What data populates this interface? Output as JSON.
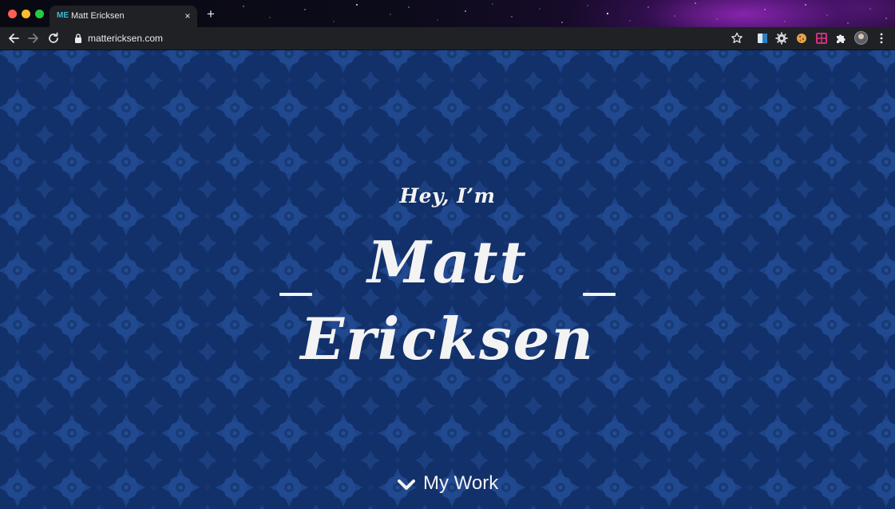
{
  "browser": {
    "tab": {
      "favicon_text": "ME",
      "title": "Matt Ericksen",
      "close_glyph": "×"
    },
    "new_tab_glyph": "+",
    "address_bar": {
      "url": "mattericksen.com"
    },
    "extensions": [
      "reader-extension-icon",
      "settings-gear-extension-icon",
      "cookie-extension-icon",
      "pink-grid-extension-icon"
    ]
  },
  "hero": {
    "greeting": "Hey, I’m",
    "name_first": "Matt",
    "name_last": "Ericksen",
    "cta_label": "My Work"
  },
  "colors": {
    "background": "#12306a",
    "pattern": "#1e4488",
    "text": "#f3f3f3",
    "toolbar": "#202124"
  }
}
